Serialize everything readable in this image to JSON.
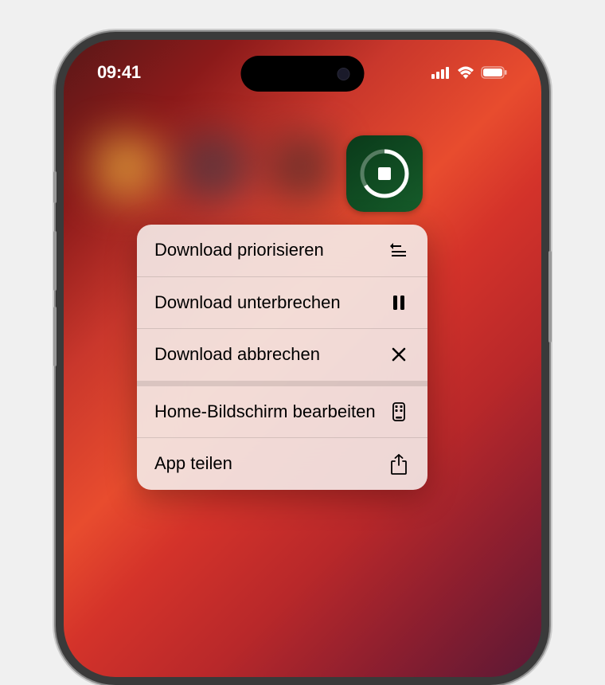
{
  "statusBar": {
    "time": "09:41"
  },
  "menu": {
    "prioritize": "Download priorisieren",
    "pause": "Download unterbrechen",
    "cancel": "Download abbrechen",
    "editHome": "Home-Bildschirm bearbeiten",
    "share": "App teilen"
  }
}
